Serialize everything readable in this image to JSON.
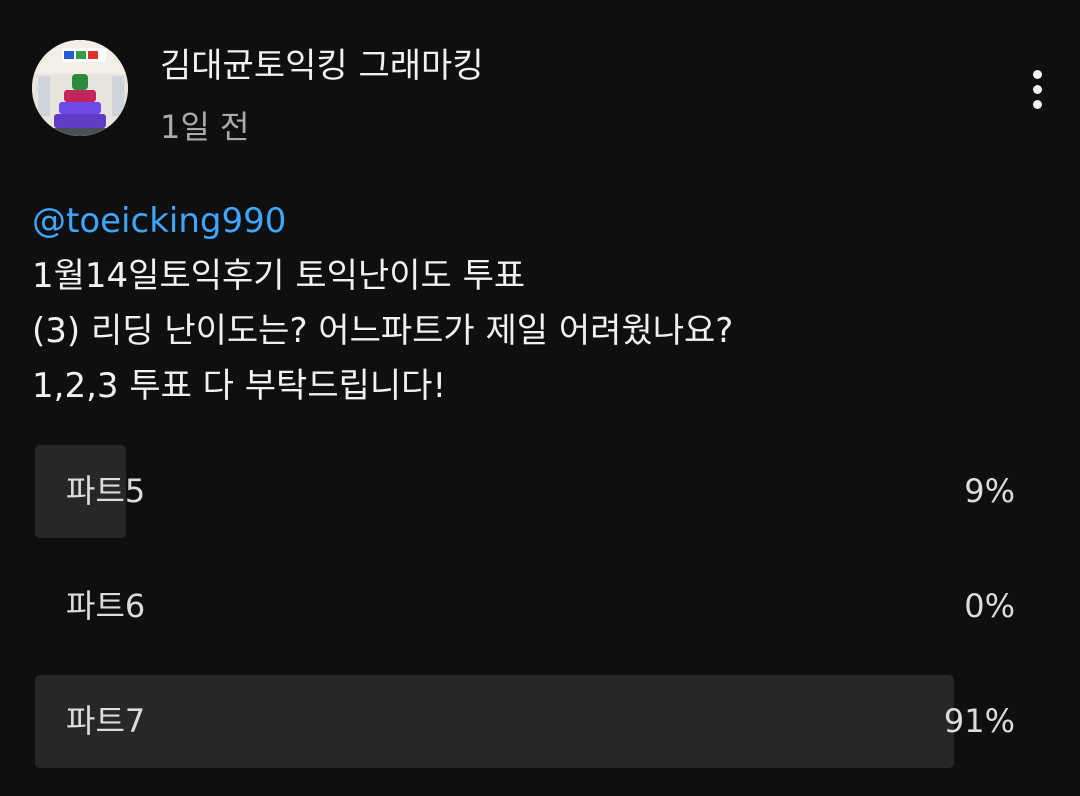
{
  "post": {
    "author": "김대균토익킹 그래마킹",
    "time": "1일 전",
    "mention": "@toeicking990",
    "lines": [
      "1월14일토익후기 토익난이도 투표",
      "(3) 리딩 난이도는?  어느파트가 제일 어려웠나요?",
      "1,2,3 투표 다 부탁드립니다!"
    ],
    "avatar_icon": "channel-avatar",
    "menu_icon": "more-vert-icon"
  },
  "poll": {
    "options": [
      {
        "label": "파트5",
        "percent_label": "9%",
        "percent": 9
      },
      {
        "label": "파트6",
        "percent_label": "0%",
        "percent": 0
      },
      {
        "label": "파트7",
        "percent_label": "91%",
        "percent": 91
      }
    ],
    "bar_color": "#272727"
  },
  "colors": {
    "background": "#0f0f0f",
    "text": "#f1f1f1",
    "secondary_text": "#aaaaaa",
    "link": "#3ea6ff"
  }
}
